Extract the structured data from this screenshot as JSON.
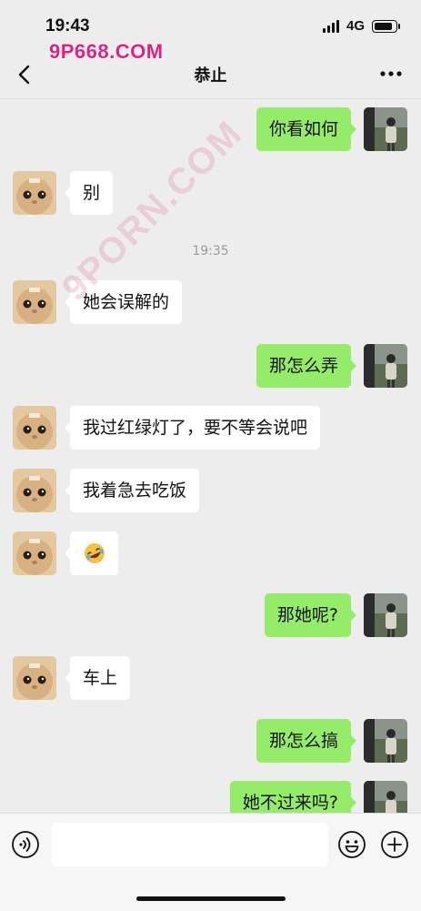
{
  "status_bar": {
    "time": "19:43",
    "network": "4G",
    "battery_level": 0.9
  },
  "header": {
    "title": "恭止",
    "watermark": "9P668.COM",
    "overlay_watermark": "9PORN.COM"
  },
  "messages": [
    {
      "sender": "me",
      "text": "你看如何"
    },
    {
      "sender": "other",
      "text": "别"
    },
    {
      "type": "time",
      "text": "19:35"
    },
    {
      "sender": "other",
      "text": "她会误解的"
    },
    {
      "sender": "me",
      "text": "那怎么弄"
    },
    {
      "sender": "other",
      "text": "我过红绿灯了，要不等会说吧"
    },
    {
      "sender": "other",
      "text": "我着急去吃饭"
    },
    {
      "sender": "other",
      "text": "",
      "emoji": "rolling-laughing"
    },
    {
      "sender": "me",
      "text": "那她呢?"
    },
    {
      "sender": "other",
      "text": "车上"
    },
    {
      "sender": "me",
      "text": "那怎么搞"
    },
    {
      "sender": "me",
      "text": "她不过来吗?"
    }
  ],
  "input": {
    "value": "",
    "placeholder": ""
  },
  "colors": {
    "sent_bubble": "#95ec69",
    "received_bubble": "#ffffff",
    "background": "#ededed",
    "watermark": "#e91e7a"
  },
  "icons": {
    "back": "chevron-left-icon",
    "more": "more-dots-icon",
    "voice": "voice-icon",
    "emoji": "smile-icon",
    "add": "plus-icon"
  }
}
